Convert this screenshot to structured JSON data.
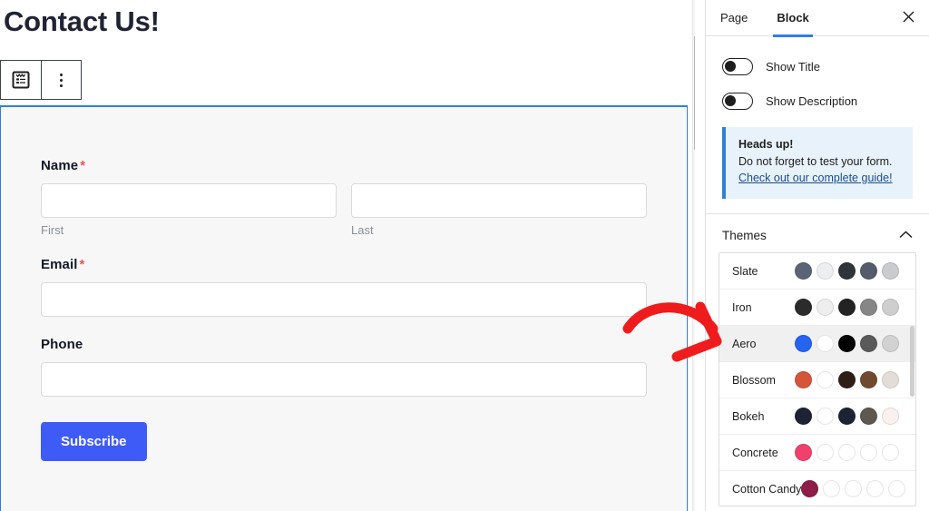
{
  "canvas": {
    "page_title": "Contact Us!",
    "toolbar": {
      "form_block_icon": "form-block-icon",
      "more_options_icon": "more-options-vertical-dots-icon"
    },
    "form": {
      "fields": [
        {
          "label": "Name",
          "required_mark": "*",
          "type": "name",
          "inputs": [
            {
              "value": "",
              "placeholder": "",
              "sublabel": "First"
            },
            {
              "value": "",
              "placeholder": "",
              "sublabel": "Last"
            }
          ]
        },
        {
          "label": "Email",
          "required_mark": "*",
          "type": "email",
          "inputs": [
            {
              "value": "",
              "placeholder": "",
              "sublabel": ""
            }
          ]
        },
        {
          "label": "Phone",
          "required_mark": "",
          "type": "tel",
          "inputs": [
            {
              "value": "",
              "placeholder": "",
              "sublabel": ""
            }
          ]
        }
      ],
      "submit_label": "Subscribe",
      "submit_color": "#3e5cf5"
    }
  },
  "sidebar": {
    "tabs": [
      {
        "label": "Page",
        "active": false
      },
      {
        "label": "Block",
        "active": true
      }
    ],
    "close_icon": "close-icon",
    "active_tab_color": "#2f80d8",
    "toggles": [
      {
        "label": "Show Title",
        "on": false
      },
      {
        "label": "Show Description",
        "on": false
      }
    ],
    "notice": {
      "title": "Heads up!",
      "text": "Do not forget to test your form.",
      "link": "Check out our complete guide!",
      "accent": "#2f80d8",
      "background": "#e8f2fb"
    },
    "themes_section": {
      "title": "Themes",
      "collapse_icon": "chevron-up-icon",
      "items": [
        {
          "name": "Slate",
          "selected": false,
          "colors": [
            "#5b6377",
            "#eceef0",
            "#2f333a",
            "#545c6b",
            "#c9cbce"
          ]
        },
        {
          "name": "Iron",
          "selected": false,
          "colors": [
            "#2b2b2b",
            "#eeeeee",
            "#232323",
            "#868686",
            "#cecece"
          ]
        },
        {
          "name": "Aero",
          "selected": true,
          "colors": [
            "#2563f0",
            "#ffffff",
            "#000000",
            "#5a5a5a",
            "#d2d2d2"
          ]
        },
        {
          "name": "Blossom",
          "selected": false,
          "colors": [
            "#d4553a",
            "#ffffff",
            "#2e1f16",
            "#6f4a2e",
            "#e3ddd8"
          ]
        },
        {
          "name": "Bokeh",
          "selected": false,
          "colors": [
            "#1d2235",
            "#ffffff",
            "#1d2235",
            "#5f584e",
            "#faf0ee"
          ]
        },
        {
          "name": "Concrete",
          "selected": false,
          "colors": [
            "#f0416c",
            "#ffffff",
            "#ffffff",
            "#ffffff",
            "#ffffff"
          ]
        },
        {
          "name": "Cotton Candy",
          "selected": false,
          "colors": [
            "#8e1d48",
            "#ffffff",
            "#ffffff",
            "#ffffff",
            "#ffffff"
          ]
        }
      ]
    }
  },
  "annotation": {
    "arrow_color": "#ee1c1c",
    "points_to": "Aero"
  }
}
